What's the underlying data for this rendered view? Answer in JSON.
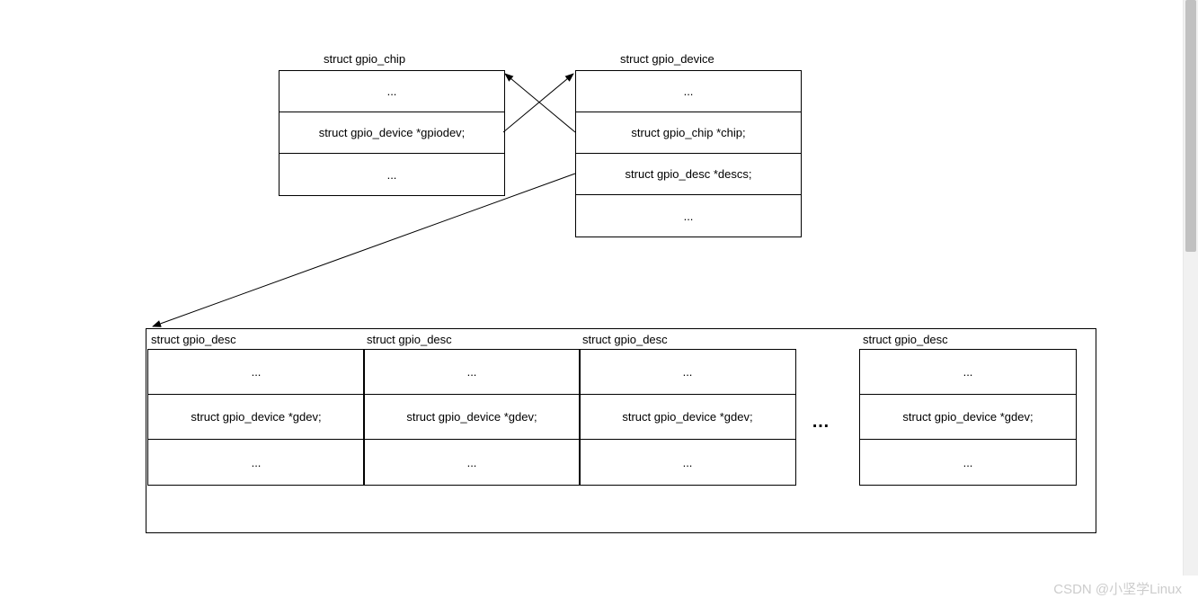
{
  "top_left": {
    "title": "struct gpio_chip",
    "rows": [
      "...",
      "struct gpio_device *gpiodev;",
      "..."
    ]
  },
  "top_right": {
    "title": "struct gpio_device",
    "rows": [
      "...",
      "struct gpio_chip *chip;",
      "struct gpio_desc *descs;",
      "..."
    ]
  },
  "desc_array": {
    "title": "struct gpio_desc",
    "rows": [
      "...",
      "struct gpio_device *gdev;",
      "..."
    ]
  },
  "ellipsis": "…",
  "watermark": "CSDN @小坚学Linux"
}
